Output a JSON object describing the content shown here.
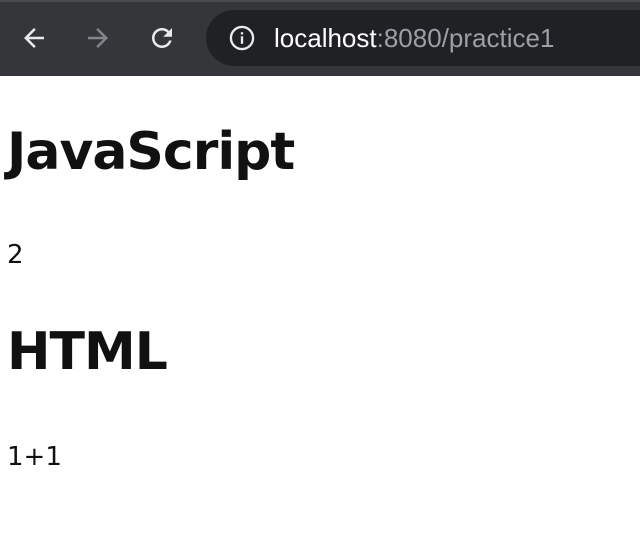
{
  "browser": {
    "url_host": "localhost",
    "url_rest": ":8080/practice1",
    "icons": {
      "back": "back-arrow-icon",
      "forward": "forward-arrow-icon",
      "reload": "reload-icon",
      "site_info": "info-icon"
    },
    "colors": {
      "toolbar": "#35363a",
      "omnibox": "#202124",
      "icon_active": "#e8eaed",
      "icon_disabled": "#80868b"
    }
  },
  "page": {
    "sections": [
      {
        "heading": "JavaScript",
        "text": "2"
      },
      {
        "heading": "HTML",
        "text": "1+1"
      }
    ]
  }
}
